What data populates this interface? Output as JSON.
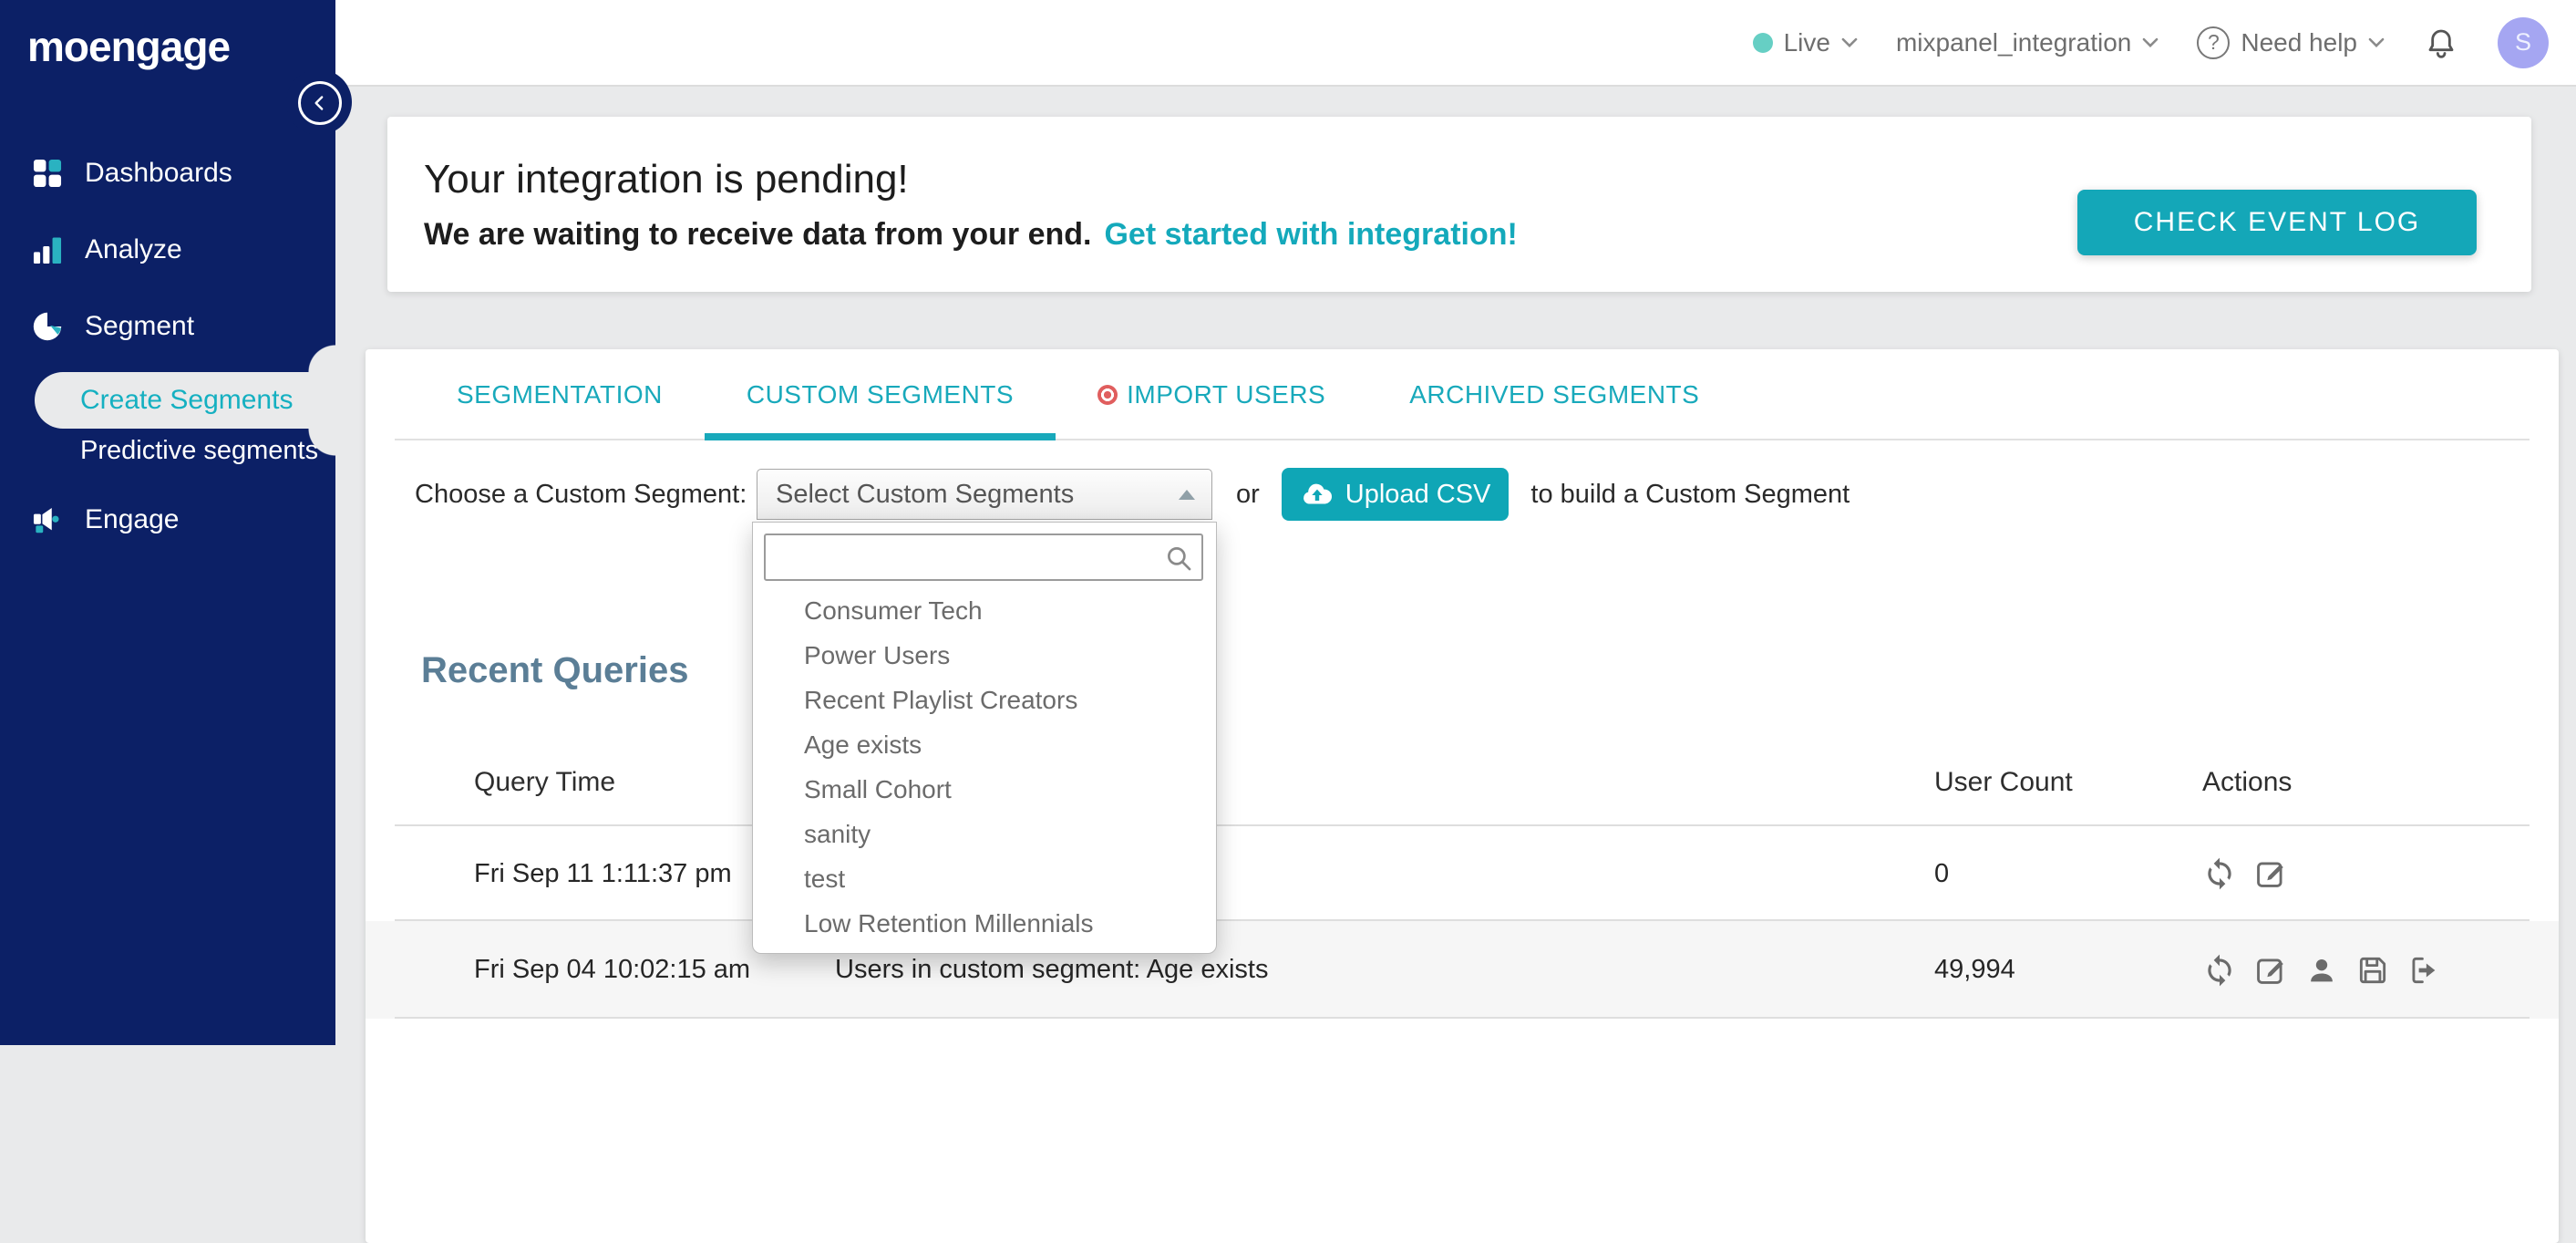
{
  "colors": {
    "sidebar_navy": "#0c2066",
    "accent_teal": "#14a7b8",
    "icon_teal": "#2ab2c1",
    "live_dot": "#66cfc4",
    "import_users_dot": "#e05e5e",
    "avatar_bg": "#a5a6f2",
    "heading_slate": "#5b7e96",
    "row_alt_bg": "#f6f6f6"
  },
  "sidebar": {
    "logo": "moengage",
    "collapse_icon": "chevron-left-icon",
    "items": [
      {
        "label": "Dashboards",
        "icon": "grid-icon"
      },
      {
        "label": "Analyze",
        "icon": "bar-chart-icon"
      },
      {
        "label": "Segment",
        "icon": "pie-chart-icon"
      },
      {
        "label": "Create Segments",
        "active": true
      },
      {
        "label": "Predictive segments"
      },
      {
        "label": "Engage",
        "icon": "megaphone-icon"
      }
    ]
  },
  "topbar": {
    "live_label": "Live",
    "workspace": "mixpanel_integration",
    "help_label": "Need help",
    "avatar_initial": "S",
    "icons": [
      "live-dot",
      "chevron-down-icon",
      "question-circle-icon",
      "bell-icon",
      "avatar"
    ]
  },
  "banner": {
    "title": "Your integration is pending!",
    "subtitle": "We are waiting to receive data from your end.",
    "link_text": "Get started with integration!",
    "button_label": "CHECK EVENT LOG"
  },
  "tabs": [
    {
      "label": "SEGMENTATION",
      "active": false
    },
    {
      "label": "CUSTOM SEGMENTS",
      "active": true
    },
    {
      "label": "IMPORT USERS",
      "active": false,
      "badge_icon": "record-dot-icon"
    },
    {
      "label": "ARCHIVED SEGMENTS",
      "active": false
    }
  ],
  "segment_picker": {
    "label": "Choose a Custom Segment:",
    "select_value": "Select Custom Segments",
    "select_state_icon": "triangle-up-icon",
    "search_value": "",
    "search_icon": "search-icon",
    "options": [
      "Consumer Tech",
      "Power Users",
      "Recent Playlist Creators",
      "Age exists",
      "Small Cohort",
      "sanity",
      "test",
      "Low Retention Millennials"
    ],
    "or_text": "or",
    "upload_button": "Upload CSV",
    "upload_icon": "cloud-upload-icon",
    "suffix_text": "to build a Custom Segment"
  },
  "recent_queries": {
    "title": "Recent Queries",
    "columns": {
      "query_time": "Query Time",
      "description": "",
      "user_count": "User Count",
      "actions": "Actions"
    },
    "rows": [
      {
        "query_time": "Fri Sep 11 1:11:37 pm",
        "description": "",
        "user_count": "0",
        "actions": [
          "refresh-icon",
          "edit-icon"
        ]
      },
      {
        "query_time": "Fri Sep 04 10:02:15 am",
        "description": "Users in custom segment: Age exists",
        "user_count": "49,994",
        "actions": [
          "refresh-icon",
          "edit-icon",
          "user-icon",
          "save-icon",
          "export-icon"
        ]
      }
    ]
  }
}
